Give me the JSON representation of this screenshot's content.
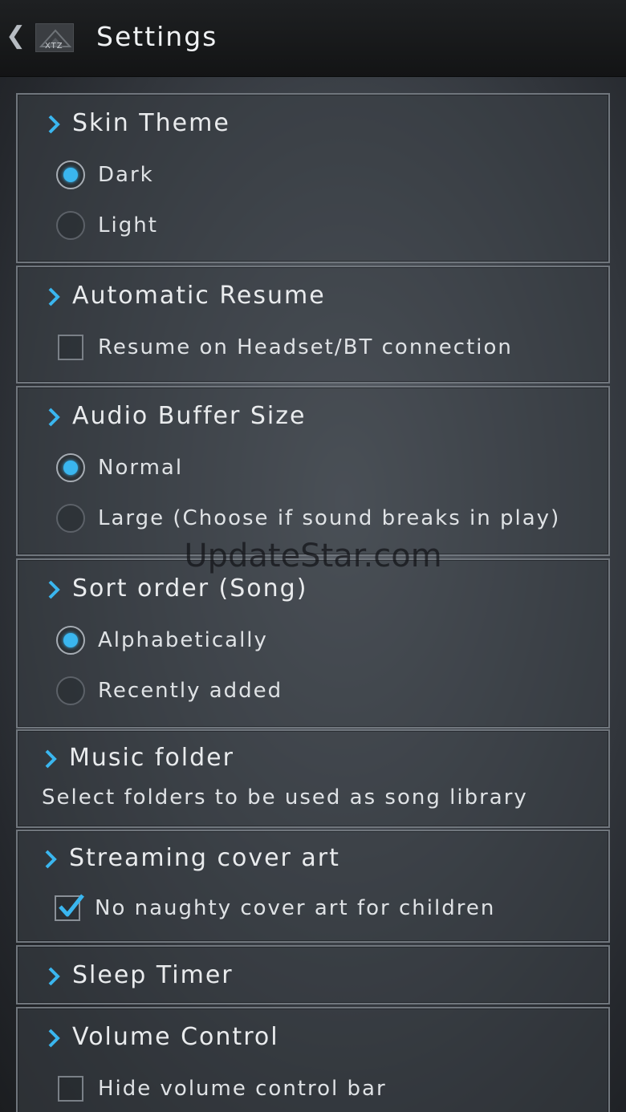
{
  "header": {
    "title": "Settings",
    "back_icon": "chevron-left-icon",
    "logo_text": "XTZ"
  },
  "colors": {
    "accent": "#3ab6ef",
    "panel_border": "#70767d",
    "topbar": "#1a1c1e"
  },
  "sections": {
    "skin_theme": {
      "title": "Skin Theme",
      "options": [
        {
          "label": "Dark",
          "selected": true
        },
        {
          "label": "Light",
          "selected": false
        }
      ]
    },
    "automatic_resume": {
      "title": "Automatic Resume",
      "checkbox": {
        "label": "Resume on Headset/BT connection",
        "checked": false
      }
    },
    "audio_buffer_size": {
      "title": "Audio Buffer Size",
      "options": [
        {
          "label": "Normal",
          "selected": true
        },
        {
          "label": "Large (Choose if sound breaks in play)",
          "selected": false
        }
      ]
    },
    "sort_order": {
      "title": "Sort order (Song)",
      "options": [
        {
          "label": "Alphabetically",
          "selected": true
        },
        {
          "label": "Recently added",
          "selected": false
        }
      ]
    },
    "music_folder": {
      "title": "Music folder",
      "description": "Select folders to be used as song library"
    },
    "streaming_cover_art": {
      "title": "Streaming cover art",
      "checkbox": {
        "label": "No naughty cover art for children",
        "checked": true
      }
    },
    "sleep_timer": {
      "title": "Sleep Timer"
    },
    "volume_control": {
      "title": "Volume Control",
      "checkbox": {
        "label": "Hide volume control bar",
        "checked": false
      }
    }
  },
  "watermark": "UpdateStar.com"
}
